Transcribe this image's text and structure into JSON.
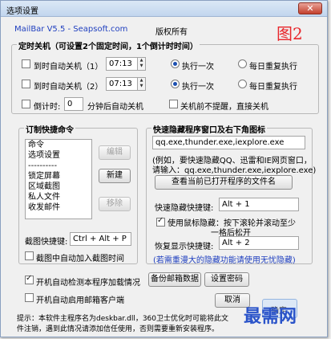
{
  "window": {
    "title": "选项设置",
    "close": "✕"
  },
  "header": {
    "product": "MailBar V5.5 - Seapsoft.com",
    "copyright": "版权所有",
    "figure_label": "图2"
  },
  "shutdown": {
    "legend": "定时关机（可设置2个固定时间，1个倒计时时间）",
    "row1": {
      "label": "到时自动关机（1）",
      "time": "07:13",
      "once": "执行一次",
      "daily": "每日重复执行"
    },
    "row2": {
      "label": "到时自动关机（2）",
      "time": "07:13",
      "once": "执行一次",
      "daily": "每日重复执行"
    },
    "countdown": {
      "label": "倒计时:",
      "value": "0",
      "suffix": "分钟后自动关机",
      "noprompt": "关机前不提醒，直接关机"
    }
  },
  "shortcut": {
    "legend": "订制快捷命令",
    "items": [
      "命令",
      "选项设置",
      "----------",
      "锁定屏幕",
      "区域截图",
      "私人文件",
      "收发邮件"
    ],
    "edit_btn": "编辑",
    "new_btn": "新建",
    "remove_btn": "移除",
    "hotkey_label": "截图快捷键:",
    "hotkey_value": "Ctrl + Alt + P",
    "autoadd": "截图中自动加入截图时间"
  },
  "hide": {
    "legend": "快速隐藏程序窗口及右下角图标",
    "programs": "qq.exe,thunder.exe,iexplore.exe",
    "example_line1": "(例如，要快速隐藏QQ、迅雷和IE网页窗口，",
    "example_line2": "请输入：qq.exe,thunder.exe,iexplore.exe)",
    "view_btn": "查看当前已打开程序的文件名",
    "hide_label": "快速隐藏快捷键:",
    "hide_value": "Alt + 1",
    "mouse_line1": "使用鼠标隐藏：按下滚轮并滚动至少",
    "mouse_line2": "一格后松开",
    "restore_label": "恢复显示快捷键:",
    "restore_value": "Alt + 2",
    "note": "(若需重漫大的隐藏功能请使用无忧隐藏)"
  },
  "bottom": {
    "autodetect": "开机自动检测本程序加载情况",
    "autostart": "开机自动启用邮箱客户端",
    "backup_btn": "备份邮箱数据",
    "password_btn": "设置密码",
    "cancel_btn": "取消",
    "ok_btn": "确定",
    "tip_line1": "提示：本软件主程序名为deskbar.dll，360卫士优化时可能将此文",
    "tip_line2": "件注销，遇到此情况请添加信任使用，否则需要重新安装程序。",
    "watermark": "最需网"
  }
}
